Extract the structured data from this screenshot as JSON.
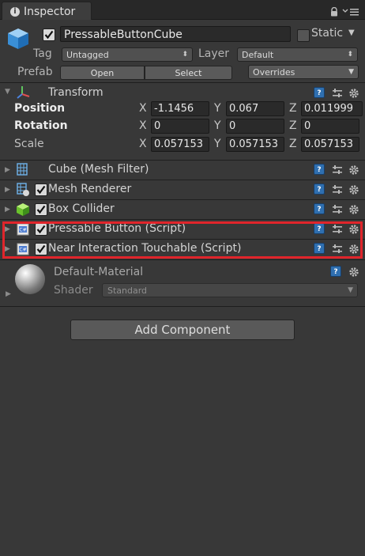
{
  "window": {
    "tab_label": "Inspector",
    "tab_icon": "info-icon",
    "tab_icon_glyph": "i"
  },
  "header": {
    "object_name": "PressableButtonCube",
    "active": true,
    "static_label": "Static",
    "static_checked": false,
    "tag_label": "Tag",
    "tag_value": "Untagged",
    "layer_label": "Layer",
    "layer_value": "Default",
    "prefab_label": "Prefab",
    "open_label": "Open",
    "select_label": "Select",
    "overrides_label": "Overrides"
  },
  "transform": {
    "title": "Transform",
    "position_label": "Position",
    "rotation_label": "Rotation",
    "scale_label": "Scale",
    "axis_x": "X",
    "axis_y": "Y",
    "axis_z": "Z",
    "position": {
      "x": "-1.1456",
      "y": "0.067",
      "z": "0.011999"
    },
    "rotation": {
      "x": "0",
      "y": "0",
      "z": "0"
    },
    "scale": {
      "x": "0.057153",
      "y": "0.057153",
      "z": "0.057153"
    }
  },
  "components": [
    {
      "title": "Cube (Mesh Filter)",
      "has_checkbox": false,
      "icon": "mesh-filter-icon"
    },
    {
      "title": "Mesh Renderer",
      "has_checkbox": true,
      "checked": true,
      "icon": "mesh-renderer-icon"
    },
    {
      "title": "Box Collider",
      "has_checkbox": true,
      "checked": true,
      "icon": "box-collider-icon"
    },
    {
      "title": "Pressable Button (Script)",
      "has_checkbox": true,
      "checked": true,
      "icon": "script-icon"
    },
    {
      "title": "Near Interaction Touchable (Script)",
      "has_checkbox": true,
      "checked": true,
      "icon": "script-icon"
    }
  ],
  "icons": {
    "help": "?",
    "fold_glyph": "▶",
    "dropdown_glyph": "⬍",
    "caret_glyph": "▼"
  },
  "material": {
    "name": "Default-Material",
    "shader_label": "Shader",
    "shader_value": "Standard"
  },
  "add_component_label": "Add Component",
  "colors": {
    "background": "#383838",
    "highlight": "#e0252b",
    "help_blue": "#2f6fb0",
    "field_bg": "#2a2a2a"
  }
}
